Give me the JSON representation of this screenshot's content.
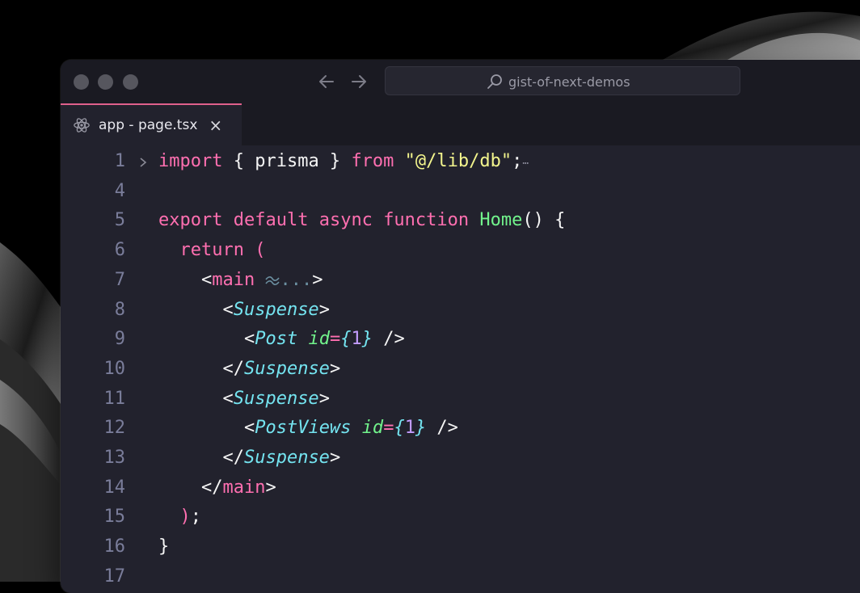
{
  "window": {
    "search_text": "gist-of-next-demos"
  },
  "tab": {
    "title": "app - page.tsx",
    "close_glyph": "×"
  },
  "icons": {
    "back": "arrow-left-icon",
    "forward": "arrow-right-icon",
    "search": "search-icon",
    "tab": "react-icon",
    "fold": "chevron-right-icon",
    "tailwind": "tailwind-icon"
  },
  "colors": {
    "keyword": "#ff6fb0",
    "function": "#72f48c",
    "string": "#f3f58d",
    "component": "#74e4f0",
    "number": "#c39cff",
    "accent_tab": "#e0608c",
    "editor_bg": "#22222d"
  },
  "lines": [
    {
      "n": "1",
      "tokens": [
        {
          "t": "import",
          "c": "kw"
        },
        {
          "t": " { prisma } ",
          "c": "pun"
        },
        {
          "t": "from",
          "c": "kw"
        },
        {
          "t": " ",
          "c": "pun"
        },
        {
          "t": "\"@/lib/db\"",
          "c": "str"
        },
        {
          "t": ";",
          "c": "pun"
        }
      ]
    },
    {
      "n": "4",
      "tokens": []
    },
    {
      "n": "5",
      "tokens": [
        {
          "t": "export",
          "c": "kw"
        },
        {
          "t": " ",
          "c": "pun"
        },
        {
          "t": "default",
          "c": "kw"
        },
        {
          "t": " ",
          "c": "pun"
        },
        {
          "t": "async",
          "c": "kw"
        },
        {
          "t": " ",
          "c": "pun"
        },
        {
          "t": "function",
          "c": "kw"
        },
        {
          "t": " ",
          "c": "pun"
        },
        {
          "t": "Home",
          "c": "fn"
        },
        {
          "t": "() {",
          "c": "pun"
        }
      ]
    },
    {
      "n": "6",
      "tokens": [
        {
          "t": "  ",
          "c": "pun"
        },
        {
          "t": "return",
          "c": "kw"
        },
        {
          "t": " (",
          "c": "kw"
        }
      ]
    },
    {
      "n": "7",
      "tokens": [
        {
          "t": "    <",
          "c": "pun"
        },
        {
          "t": "main",
          "c": "tag"
        }
      ]
    },
    {
      "n": "8",
      "tokens": [
        {
          "t": "      <",
          "c": "pun"
        },
        {
          "t": "Suspense",
          "c": "comp"
        },
        {
          "t": ">",
          "c": "pun"
        }
      ]
    },
    {
      "n": "9",
      "tokens": [
        {
          "t": "        <",
          "c": "pun"
        },
        {
          "t": "Post",
          "c": "comp"
        },
        {
          "t": " ",
          "c": "pun"
        },
        {
          "t": "id",
          "c": "attr"
        },
        {
          "t": "=",
          "c": "kw"
        },
        {
          "t": "{",
          "c": "comp"
        },
        {
          "t": "1",
          "c": "num"
        },
        {
          "t": "}",
          "c": "comp"
        },
        {
          "t": " />",
          "c": "pun"
        }
      ]
    },
    {
      "n": "10",
      "tokens": [
        {
          "t": "      </",
          "c": "pun"
        },
        {
          "t": "Suspense",
          "c": "comp"
        },
        {
          "t": ">",
          "c": "pun"
        }
      ]
    },
    {
      "n": "11",
      "tokens": [
        {
          "t": "      <",
          "c": "pun"
        },
        {
          "t": "Suspense",
          "c": "comp"
        },
        {
          "t": ">",
          "c": "pun"
        }
      ]
    },
    {
      "n": "12",
      "tokens": [
        {
          "t": "        <",
          "c": "pun"
        },
        {
          "t": "PostViews",
          "c": "comp"
        },
        {
          "t": " ",
          "c": "pun"
        },
        {
          "t": "id",
          "c": "attr"
        },
        {
          "t": "=",
          "c": "kw"
        },
        {
          "t": "{",
          "c": "comp"
        },
        {
          "t": "1",
          "c": "num"
        },
        {
          "t": "}",
          "c": "comp"
        },
        {
          "t": " />",
          "c": "pun"
        }
      ]
    },
    {
      "n": "13",
      "tokens": [
        {
          "t": "      </",
          "c": "pun"
        },
        {
          "t": "Suspense",
          "c": "comp"
        },
        {
          "t": ">",
          "c": "pun"
        }
      ]
    },
    {
      "n": "14",
      "tokens": [
        {
          "t": "    </",
          "c": "pun"
        },
        {
          "t": "main",
          "c": "tag"
        },
        {
          "t": ">",
          "c": "pun"
        }
      ]
    },
    {
      "n": "15",
      "tokens": [
        {
          "t": "  ",
          "c": "pun"
        },
        {
          "t": ")",
          "c": "kw"
        },
        {
          "t": ";",
          "c": "pun"
        }
      ]
    },
    {
      "n": "16",
      "tokens": [
        {
          "t": "}",
          "c": "pun"
        }
      ]
    },
    {
      "n": "17",
      "tokens": []
    }
  ],
  "fold_marker": {
    "line": "1",
    "ellipsis": "⋯"
  },
  "main_collapsed": {
    "dots": "...",
    "close": ">"
  }
}
